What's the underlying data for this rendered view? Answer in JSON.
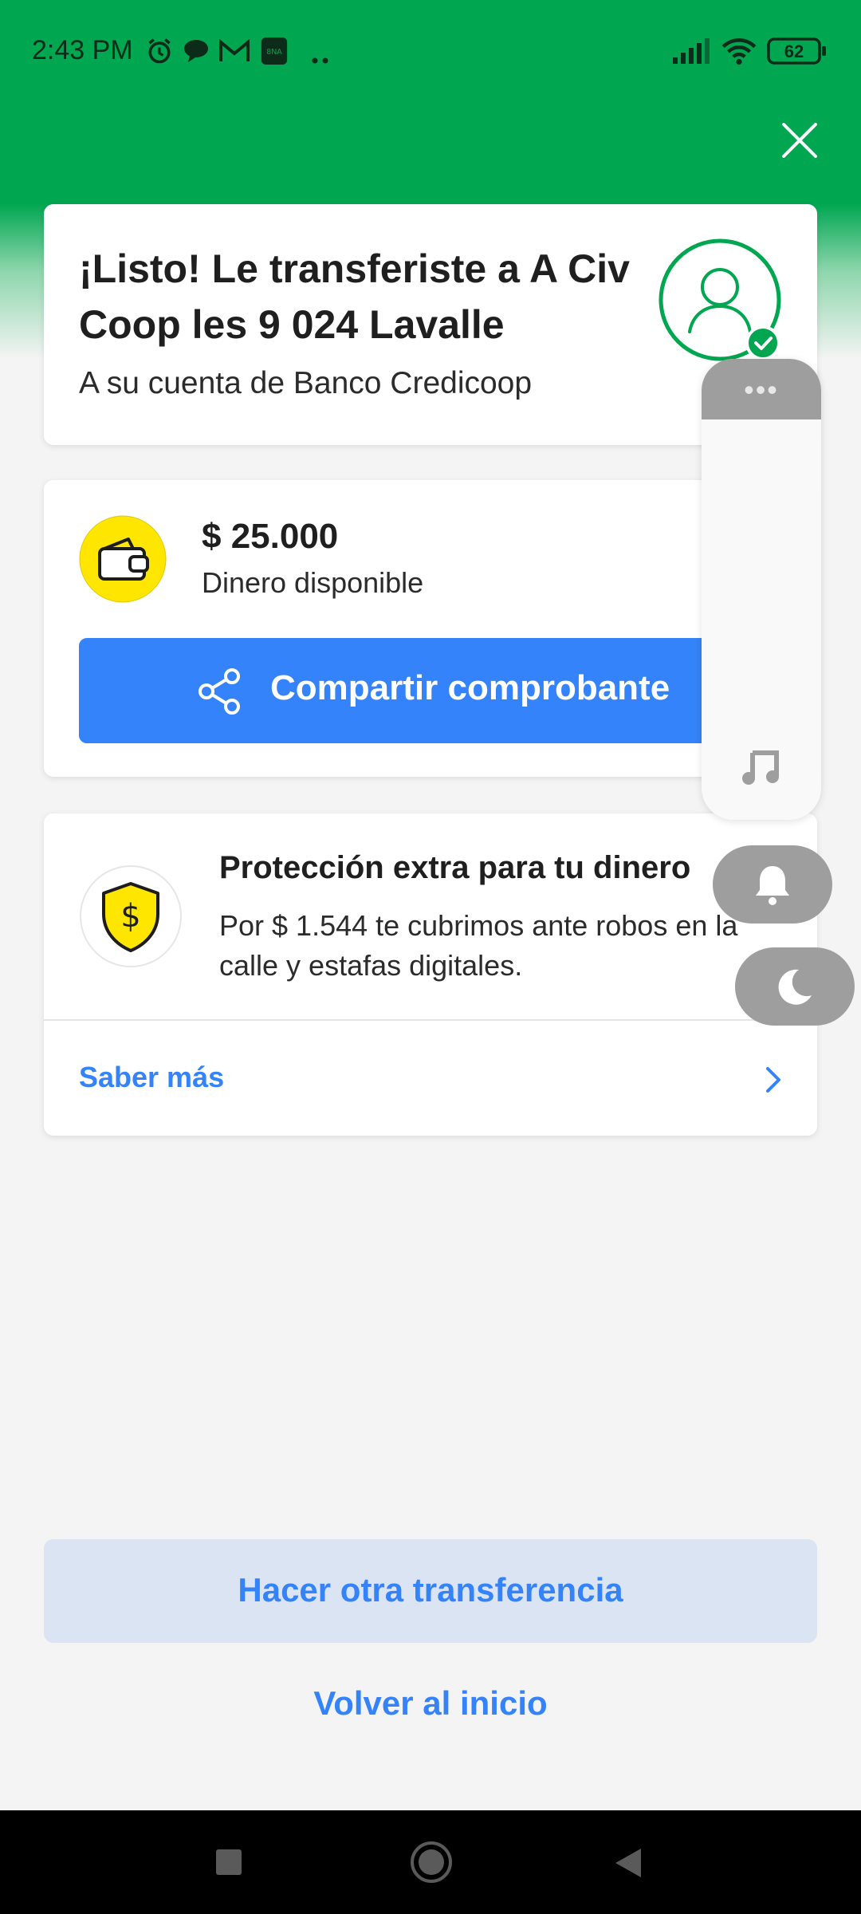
{
  "status_bar": {
    "time": "2:43 PM",
    "battery": "62",
    "icons": [
      "alarm-icon",
      "chat-icon",
      "gmail-icon",
      "app-icon",
      "more-dots-icon",
      "signal-icon",
      "wifi-icon",
      "battery-icon"
    ]
  },
  "header": {
    "close_icon": "close-icon",
    "accent": "#00a650"
  },
  "confirmation": {
    "title": "¡Listo! Le transferiste a A Civ Coop les 9 024 Lavalle",
    "subtitle": "A su cuenta de Banco Credicoop"
  },
  "balance": {
    "amount": "$ 25.000",
    "label": "Dinero disponible",
    "share_button": "Compartir comprobante"
  },
  "protection": {
    "title": "Protección extra para tu dinero",
    "description": "Por $ 1.544 te cubrimos ante robos en la calle y estafas digitales.",
    "link": "Saber más"
  },
  "actions": {
    "other_transfer": "Hacer otra transferencia",
    "back_home": "Volver al inicio"
  },
  "overlay": {
    "dots": "•••",
    "icons": [
      "music-note-icon",
      "bell-icon",
      "moon-icon"
    ]
  },
  "colors": {
    "brand_green": "#00a650",
    "brand_blue": "#3483fa",
    "light_blue": "#dae4f2",
    "yellow": "#ffe600"
  }
}
